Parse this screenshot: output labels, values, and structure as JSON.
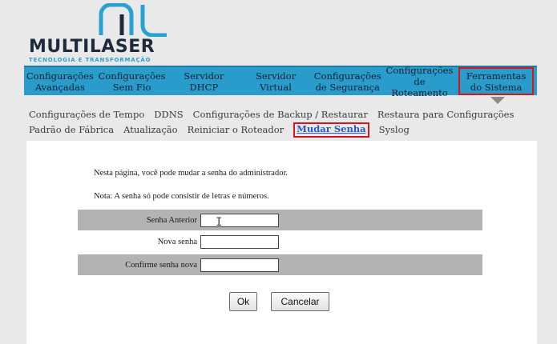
{
  "brand": {
    "name": "MULTILASER",
    "tagline": "TECNOLOGIA E TRANSFORMAÇÃO"
  },
  "main_nav": [
    {
      "line1": "Configurações",
      "line2": "Avançadas",
      "active": false
    },
    {
      "line1": "Configurações",
      "line2": "Sem Fio",
      "active": false
    },
    {
      "line1": "Servidor",
      "line2": "DHCP",
      "active": false
    },
    {
      "line1": "Servidor",
      "line2": "Virtual",
      "active": false
    },
    {
      "line1": "Configurações",
      "line2": "de Segurança",
      "active": false
    },
    {
      "line1": "Configurações",
      "line2": "de Roteamento",
      "active": false
    },
    {
      "line1": "Ferramentas",
      "line2": "do Sistema",
      "active": true
    }
  ],
  "sub_nav": {
    "row1": [
      "Configurações de Tempo",
      "DDNS",
      "Configurações de Backup / Restaurar",
      "Restaura para Configurações"
    ],
    "row2": [
      "Padrão de Fábrica",
      "Atualização",
      "Reiniciar o Roteador",
      "Mudar Senha",
      "Syslog"
    ],
    "active": "Mudar Senha"
  },
  "content": {
    "intro": "Nesta página, você pode mudar a senha do administrador.",
    "note": "Nota: A senha só pode consistir de letras e números.",
    "fields": [
      {
        "label": "Senha Anterior",
        "value": ""
      },
      {
        "label": "Nova senha",
        "value": ""
      },
      {
        "label": "Confirme senha nova",
        "value": ""
      }
    ],
    "ok_label": "Ok",
    "cancel_label": "Cancelar"
  },
  "colors": {
    "nav_bg": "#2a9ccc",
    "highlight": "#d9141b",
    "active_link": "#2b57c9"
  }
}
